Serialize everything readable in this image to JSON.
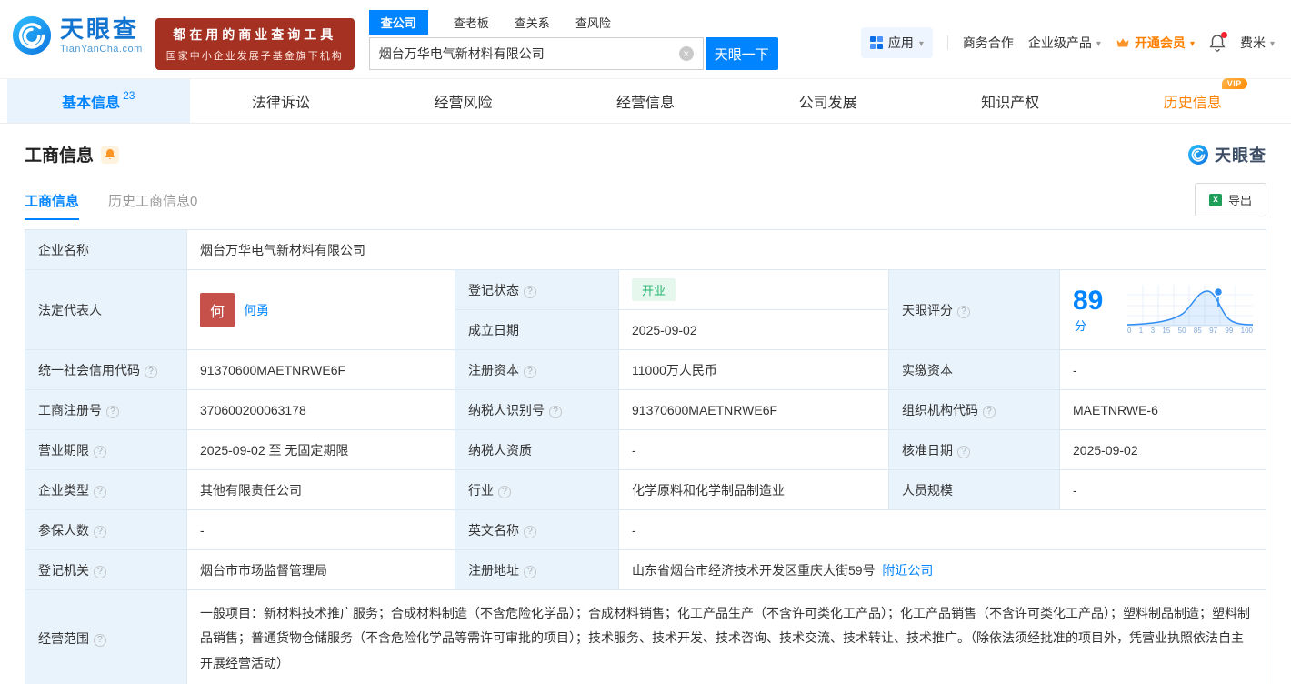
{
  "icons": {
    "caret": "▾",
    "clear": "×",
    "help": "?",
    "excel": "x"
  },
  "header": {
    "logo_cn": "天眼查",
    "logo_en": "TianYanCha.com",
    "slogan_line1": "都在用的商业查询工具",
    "slogan_line2": "国家中小企业发展子基金旗下机构",
    "search_tabs": [
      "查公司",
      "查老板",
      "查关系",
      "查风险"
    ],
    "search_value": "烟台万华电气新材料有限公司",
    "search_button": "天眼一下",
    "nav": {
      "apps": "应用",
      "cooperation": "商务合作",
      "enterprise": "企业级产品",
      "vip": "开通会员",
      "user": "费米"
    }
  },
  "tabs": [
    {
      "label": "基本信息",
      "badge": "23"
    },
    {
      "label": "法律诉讼"
    },
    {
      "label": "经营风险"
    },
    {
      "label": "经营信息"
    },
    {
      "label": "公司发展"
    },
    {
      "label": "知识产权"
    },
    {
      "label": "历史信息",
      "tag": "VIP"
    }
  ],
  "section": {
    "title": "工商信息",
    "watermark": "天眼查",
    "subtab_active": "工商信息",
    "subtab_history": "历史工商信息0",
    "export_label": "导出"
  },
  "biz": {
    "name": {
      "label": "企业名称",
      "value": "烟台万华电气新材料有限公司"
    },
    "legal": {
      "label": "法定代表人",
      "avatar": "何",
      "name": "何勇"
    },
    "status": {
      "label": "登记状态",
      "value": "开业"
    },
    "established": {
      "label": "成立日期",
      "value": "2025-09-02"
    },
    "score": {
      "label": "天眼评分",
      "value": "89",
      "unit": "分",
      "axis": [
        "0",
        "1",
        "3",
        "15",
        "50",
        "85",
        "97",
        "99",
        "100"
      ]
    },
    "credit_code": {
      "label": "统一社会信用代码",
      "value": "91370600MAETNRWE6F"
    },
    "reg_capital": {
      "label": "注册资本",
      "value": "11000万人民币"
    },
    "paid_capital": {
      "label": "实缴资本",
      "value": "-"
    },
    "reg_no": {
      "label": "工商注册号",
      "value": "370600200063178"
    },
    "tax_id": {
      "label": "纳税人识别号",
      "value": "91370600MAETNRWE6F"
    },
    "org_code": {
      "label": "组织机构代码",
      "value": "MAETNRWE-6"
    },
    "term": {
      "label": "营业期限",
      "value": "2025-09-02 至 无固定期限"
    },
    "tax_quality": {
      "label": "纳税人资质",
      "value": "-"
    },
    "approval_date": {
      "label": "核准日期",
      "value": "2025-09-02"
    },
    "type": {
      "label": "企业类型",
      "value": "其他有限责任公司"
    },
    "industry": {
      "label": "行业",
      "value": "化学原料和化学制品制造业"
    },
    "staff": {
      "label": "人员规模",
      "value": "-"
    },
    "insured": {
      "label": "参保人数",
      "value": "-"
    },
    "en_name": {
      "label": "英文名称",
      "value": "-"
    },
    "authority": {
      "label": "登记机关",
      "value": "烟台市市场监督管理局"
    },
    "address": {
      "label": "注册地址",
      "value": "山东省烟台市经济技术开发区重庆大街59号",
      "link": "附近公司"
    },
    "scope": {
      "label": "经营范围",
      "value": "一般项目：新材料技术推广服务；合成材料制造（不含危险化学品）；合成材料销售；化工产品生产（不含许可类化工产品）；化工产品销售（不含许可类化工产品）；塑料制品制造；塑料制品销售；普通货物仓储服务（不含危险化学品等需许可审批的项目）；技术服务、技术开发、技术咨询、技术交流、技术转让、技术推广。（除依法须经批准的项目外，凭营业执照依法自主开展经营活动）"
    }
  },
  "colors": {
    "accent": "#0084ff",
    "vip_orange": "#ff8000",
    "label_bg": "#e9f3fb",
    "status_green": "#23b571",
    "slogan_red": "#a53122"
  }
}
